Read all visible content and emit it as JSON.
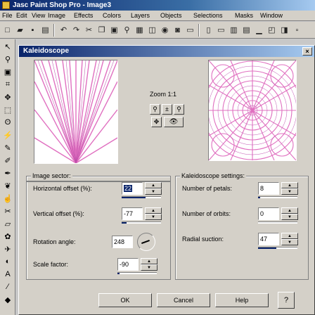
{
  "app": {
    "title": "Jasc Paint Shop Pro - Image3",
    "menu": [
      "File",
      "Edit",
      "View",
      "Image",
      "Effects",
      "Colors",
      "Layers",
      "Objects",
      "Selections",
      "Masks",
      "Window"
    ]
  },
  "dialog": {
    "title": "Kaleidoscope",
    "close_label": "×",
    "zoom_label": "Zoom 1:1",
    "image_sector": {
      "title": "Image sector:",
      "horizontal_offset": {
        "label": "Horizontal offset (%):",
        "value": "22"
      },
      "vertical_offset": {
        "label": "Vertical offset (%):",
        "value": "-77"
      },
      "rotation_angle": {
        "label": "Rotation angle:",
        "value": "248"
      },
      "scale_factor": {
        "label": "Scale factor:",
        "value": "-90"
      }
    },
    "settings": {
      "title": "Kaleidoscope settings:",
      "petals": {
        "label": "Number of petals:",
        "value": "8"
      },
      "orbits": {
        "label": "Number of orbits:",
        "value": "0"
      },
      "radial_suction": {
        "label": "Radial suction:",
        "value": "47"
      }
    },
    "buttons": {
      "ok": "OK",
      "cancel": "Cancel",
      "help": "Help"
    },
    "colors": {
      "accent": "#0a246a",
      "preview_pink": "#e070c0"
    }
  }
}
